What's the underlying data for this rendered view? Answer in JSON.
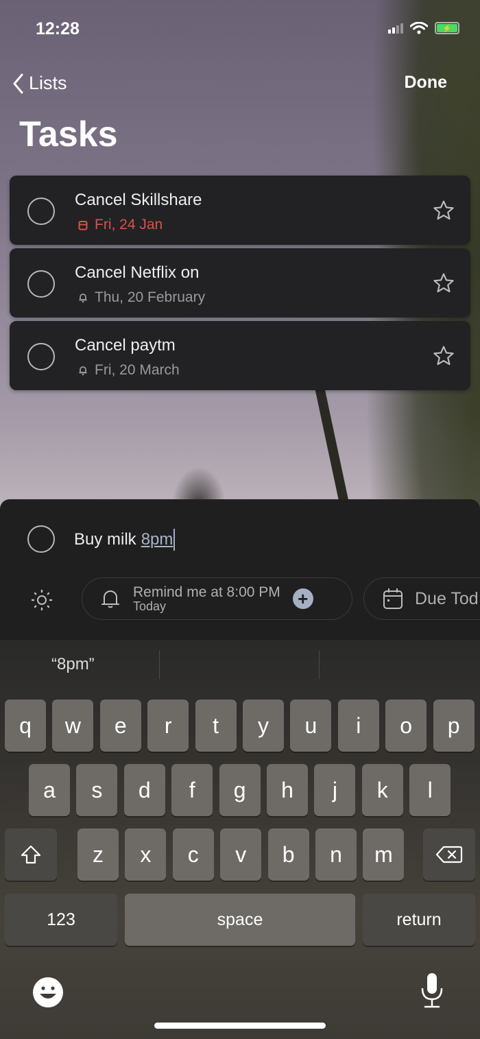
{
  "status_bar": {
    "time": "12:28"
  },
  "nav": {
    "back_label": "Lists",
    "done_label": "Done"
  },
  "page": {
    "title": "Tasks"
  },
  "tasks": [
    {
      "title": "Cancel Skillshare",
      "meta": "Fri, 24 Jan",
      "meta_icon": "calendar-icon",
      "overdue": true
    },
    {
      "title": "Cancel Netflix on",
      "meta": "Thu, 20 February",
      "meta_icon": "bell-icon",
      "overdue": false
    },
    {
      "title": "Cancel paytm",
      "meta": "Fri, 20 March",
      "meta_icon": "bell-icon",
      "overdue": false
    }
  ],
  "composer": {
    "input_text": "Buy milk",
    "input_highlight": "8pm",
    "remind_chip": {
      "main": "Remind me at 8:00 PM",
      "sub": "Today"
    },
    "due_chip": {
      "label": "Due Tod"
    }
  },
  "keyboard": {
    "suggestions": [
      "“8pm”",
      "",
      ""
    ],
    "row1": [
      "q",
      "w",
      "e",
      "r",
      "t",
      "y",
      "u",
      "i",
      "o",
      "p"
    ],
    "row2": [
      "a",
      "s",
      "d",
      "f",
      "g",
      "h",
      "j",
      "k",
      "l"
    ],
    "row3": [
      "z",
      "x",
      "c",
      "v",
      "b",
      "n",
      "m"
    ],
    "numbers_label": "123",
    "space_label": "space",
    "return_label": "return"
  },
  "colors": {
    "overdue": "#d9534a",
    "accent_plus": "#a6b0c4",
    "battery": "#4cd964"
  }
}
